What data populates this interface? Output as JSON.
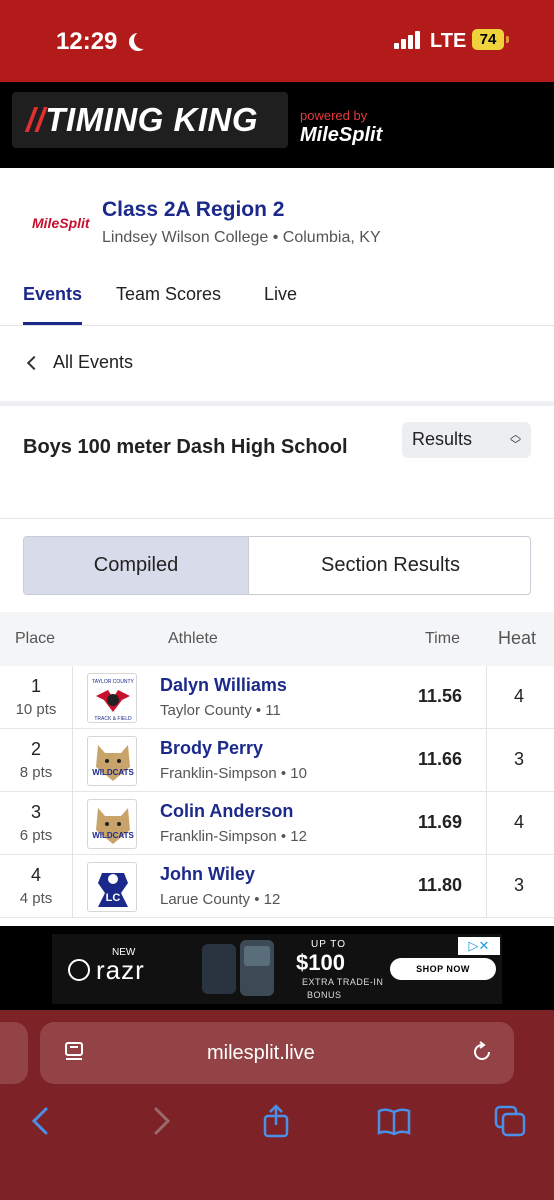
{
  "status_bar": {
    "time": "12:29",
    "network": "LTE",
    "battery": "74"
  },
  "header": {
    "brand": "TIMING KING",
    "brand_slashes": "//",
    "powered_by": "powered by",
    "milesplit": "MileSplit"
  },
  "meet": {
    "logo_text": "MileSplit",
    "title": "Class 2A Region 2",
    "location": "Lindsey Wilson College • Columbia, KY"
  },
  "tabs": [
    {
      "label": "Events",
      "active": true
    },
    {
      "label": "Team Scores",
      "active": false
    },
    {
      "label": "Live",
      "active": false
    }
  ],
  "back_link": "All Events",
  "event": {
    "title": "Boys 100 meter Dash High School",
    "select_value": "Results"
  },
  "segmented": [
    {
      "label": "Compiled",
      "active": true
    },
    {
      "label": "Section Results",
      "active": false
    }
  ],
  "table": {
    "headers": {
      "place": "Place",
      "athlete": "Athlete",
      "time": "Time",
      "heat": "Heat"
    },
    "rows": [
      {
        "place": "1",
        "pts": "10 pts",
        "name": "Dalyn Williams",
        "team": "Taylor County • 11",
        "time": "11.56",
        "heat": "4",
        "logo": "taylor-county-logo",
        "logo_text_top": "TAYLOR COUNTY",
        "logo_text_bottom": "TRACK & FIELD"
      },
      {
        "place": "2",
        "pts": "8 pts",
        "name": "Brody Perry",
        "team": "Franklin-Simpson • 10",
        "time": "11.66",
        "heat": "3",
        "logo": "wildcats-logo",
        "logo_text": "WILDCATS"
      },
      {
        "place": "3",
        "pts": "6 pts",
        "name": "Colin Anderson",
        "team": "Franklin-Simpson • 12",
        "time": "11.69",
        "heat": "4",
        "logo": "wildcats-logo",
        "logo_text": "WILDCATS"
      },
      {
        "place": "4",
        "pts": "4 pts",
        "name": "John Wiley",
        "team": "Larue County • 12",
        "time": "11.80",
        "heat": "3",
        "logo": "larue-county-logo",
        "logo_text": "LC"
      }
    ]
  },
  "ad": {
    "new": "NEW",
    "brand": "razr",
    "up_to": "UP TO",
    "amount": "$100",
    "line1": "EXTRA TRADE-IN",
    "line2": "BONUS",
    "cta": "SHOP NOW"
  },
  "browser": {
    "url": "milesplit.live"
  },
  "colors": {
    "status_bar": "#b31b1b",
    "primary": "#1b2a8a",
    "browser": "#7d2226",
    "segment_active": "#d8dcea"
  }
}
